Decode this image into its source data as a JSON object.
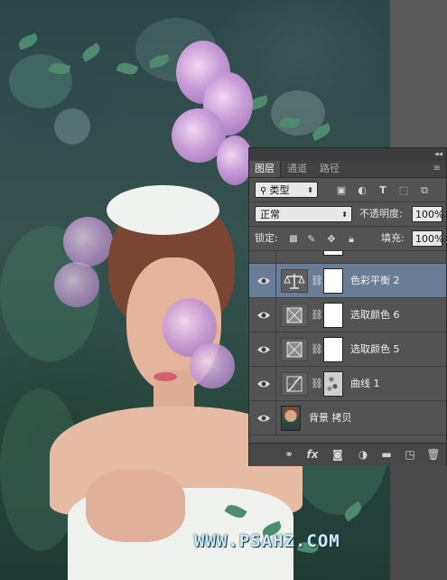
{
  "panel": {
    "tabs": [
      "图层",
      "通道",
      "路径"
    ],
    "active_tab": 0,
    "filter_label": "类型",
    "blend_mode": "正常",
    "opacity_label": "不透明度:",
    "opacity_value": "100%",
    "lock_label": "锁定:",
    "fill_label": "填充:",
    "fill_value": "100%",
    "layers": [
      {
        "name": "色彩平衡 2",
        "type": "color-balance",
        "selected": true,
        "visible": true
      },
      {
        "name": "选取颜色 6",
        "type": "selective-color",
        "selected": false,
        "visible": true
      },
      {
        "name": "选取颜色 5",
        "type": "selective-color",
        "selected": false,
        "visible": true
      },
      {
        "name": "曲线 1",
        "type": "curves",
        "selected": false,
        "visible": true
      },
      {
        "name": "背景 拷贝",
        "type": "pixel",
        "selected": false,
        "visible": true
      }
    ],
    "footer_icons": [
      "link-icon",
      "fx-icon",
      "add-mask-icon",
      "adjustment-icon",
      "folder-icon",
      "new-layer-icon",
      "trash-icon"
    ]
  },
  "watermark": "WWW.PSAHZ.COM",
  "colors": {
    "panel_bg": "#535353",
    "selected_row": "#6a7d96",
    "tab_bar": "#424242"
  }
}
